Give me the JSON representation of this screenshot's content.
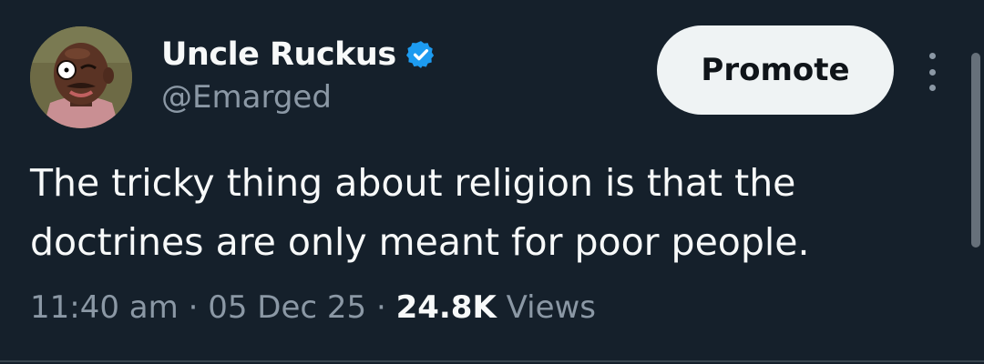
{
  "author": {
    "name": "Uncle Ruckus",
    "handle": "@Emarged",
    "verified": true,
    "verified_color": "#1d9bf0",
    "avatar_icon": "cartoon-portrait"
  },
  "actions": {
    "promote_label": "Promote",
    "more_icon": "vertical-ellipsis-icon"
  },
  "tweet": {
    "text_lines": [
      "The tricky thing about religion is that the",
      "doctrines are only meant for poor people."
    ]
  },
  "meta": {
    "time": "11:40 am",
    "separator": "·",
    "date": "05 Dec 25",
    "views_count": "24.8K",
    "views_label": "Views"
  },
  "colors": {
    "background": "#15202b",
    "primary_text": "#f7f9f9",
    "secondary_text": "#8b98a5",
    "button_bg": "#eff3f4",
    "button_text": "#0f1419"
  }
}
